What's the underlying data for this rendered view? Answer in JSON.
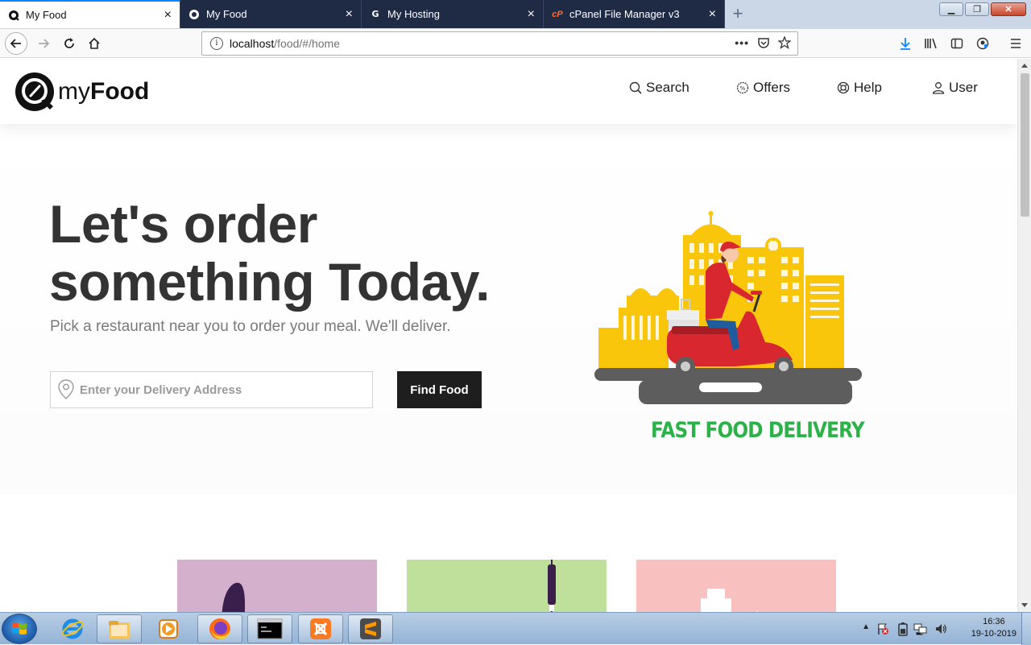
{
  "browser": {
    "tabs": [
      {
        "title": "My Food",
        "favicon": "myfood-favicon",
        "active": true
      },
      {
        "title": "My Food",
        "favicon": "myfood-favicon",
        "active": false
      },
      {
        "title": "My Hosting",
        "favicon": "g-favicon",
        "active": false
      },
      {
        "title": "cPanel File Manager v3",
        "favicon": "cpanel-favicon",
        "active": false
      }
    ],
    "url": {
      "host": "localhost",
      "path": "/food/#/home"
    }
  },
  "site": {
    "logo": {
      "light": "my",
      "bold": "Food"
    },
    "nav": {
      "search": "Search",
      "offers": "Offers",
      "help": "Help",
      "user": "User"
    },
    "hero": {
      "headline_line1": "Let's order",
      "headline_line2": "something Today.",
      "tagline": "Pick a restaurant near you to order your meal. We'll deliver.",
      "address_placeholder": "Enter your Delivery Address",
      "find_button": "Find Food",
      "illustration_caption": "FAST FOOD DELIVERY"
    },
    "cards": [
      {
        "color": "#d4b0cd"
      },
      {
        "color": "#bfe09a"
      },
      {
        "color": "#f9c0c0"
      }
    ]
  },
  "taskbar": {
    "apps": [
      "internet-explorer",
      "file-explorer",
      "media-player",
      "firefox",
      "command-prompt",
      "xampp",
      "sublime-text"
    ],
    "time": "16:36",
    "date": "19-10-2019"
  },
  "colors": {
    "accent_green": "#2db24a",
    "dark_button": "#1e1e1e",
    "headline": "#333333",
    "scooter_red": "#d8272e",
    "building_yellow": "#f9c60b"
  }
}
